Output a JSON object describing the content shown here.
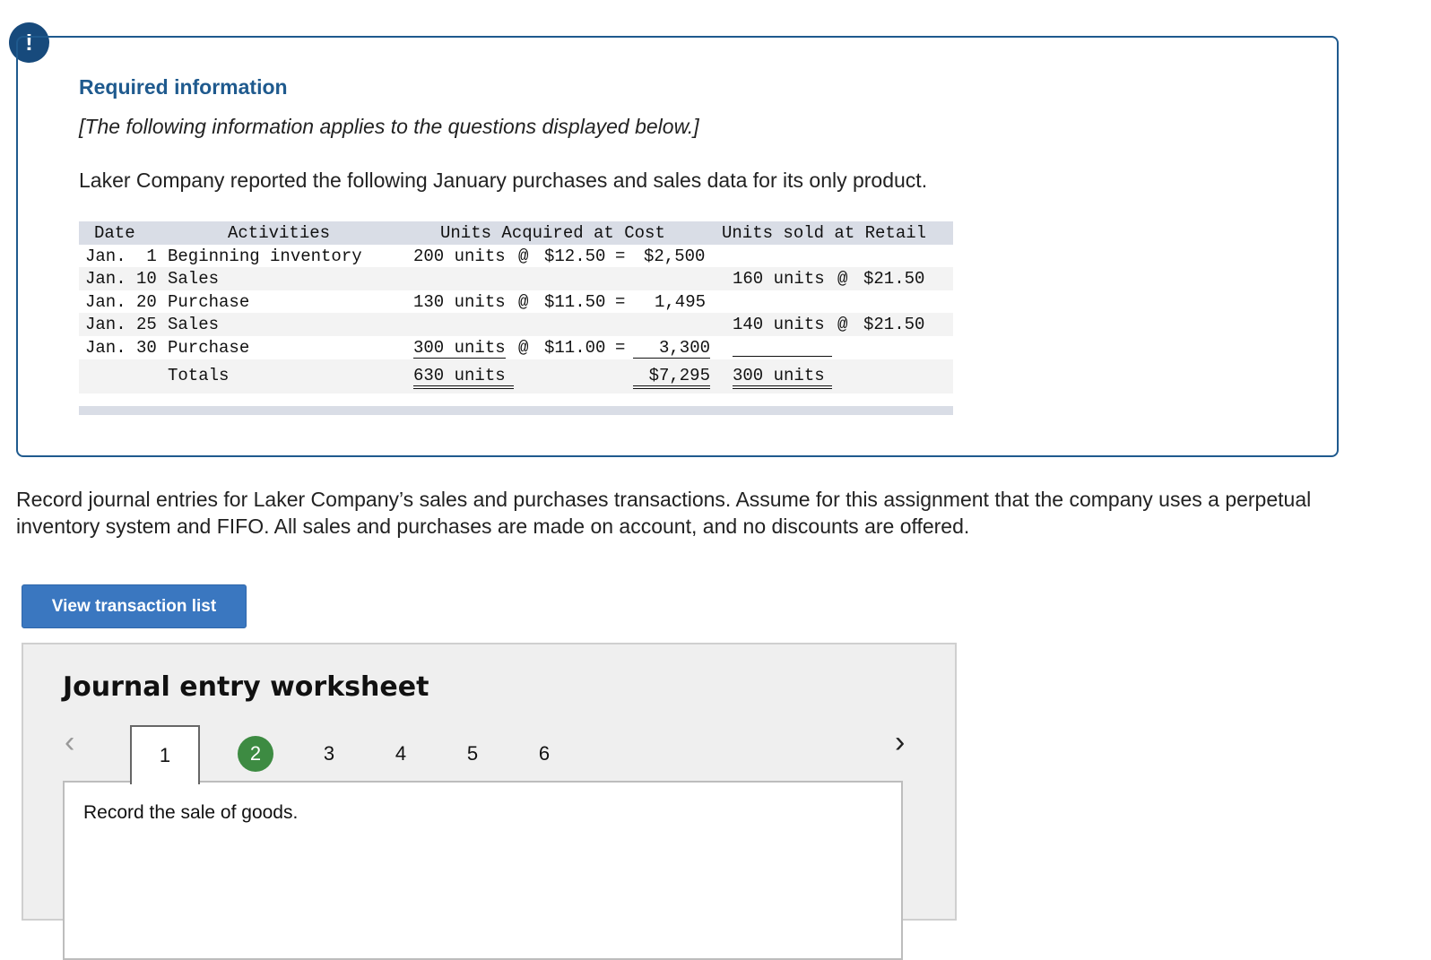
{
  "info": {
    "badge": "!",
    "title": "Required information",
    "note": "[The following information applies to the questions displayed below.]",
    "intro": "Laker Company reported the following January purchases and sales data for its only product."
  },
  "table": {
    "headers": {
      "date": "Date",
      "activities": "Activities",
      "acquired": "Units Acquired at Cost",
      "sold": "Units sold at Retail"
    },
    "rows": [
      {
        "date": "Jan.  1",
        "activity": "Beginning inventory",
        "acq_units": "200 units",
        "acq_at": "@",
        "acq_cost": "$12.50",
        "acq_eq": "=",
        "acq_total": "$2,500",
        "sold_units": "",
        "sold_at": "",
        "sold_price": ""
      },
      {
        "date": "Jan. 10",
        "activity": "Sales",
        "acq_units": "",
        "acq_at": "",
        "acq_cost": "",
        "acq_eq": "",
        "acq_total": "",
        "sold_units": "160 units",
        "sold_at": "@",
        "sold_price": "$21.50"
      },
      {
        "date": "Jan. 20",
        "activity": "Purchase",
        "acq_units": "130 units",
        "acq_at": "@",
        "acq_cost": "$11.50",
        "acq_eq": "=",
        "acq_total": "1,495",
        "sold_units": "",
        "sold_at": "",
        "sold_price": ""
      },
      {
        "date": "Jan. 25",
        "activity": "Sales",
        "acq_units": "",
        "acq_at": "",
        "acq_cost": "",
        "acq_eq": "",
        "acq_total": "",
        "sold_units": "140 units",
        "sold_at": "@",
        "sold_price": "$21.50"
      },
      {
        "date": "Jan. 30",
        "activity": "Purchase",
        "acq_units": "300 units",
        "acq_at": "@",
        "acq_cost": "$11.00",
        "acq_eq": "=",
        "acq_total": "3,300",
        "sold_units": "",
        "sold_at": "",
        "sold_price": ""
      }
    ],
    "totals": {
      "label": "Totals",
      "acq_units": "630 units",
      "acq_total": "$7,295",
      "sold_units": "300 units"
    }
  },
  "instructions": "Record journal entries for Laker Company’s sales and purchases transactions. Assume for this assignment that the company uses a perpetual inventory system and FIFO. All sales and purchases are made on account, and no discounts are offered.",
  "view_button": "View transaction list",
  "worksheet": {
    "title": "Journal entry worksheet",
    "prev_icon": "chevron-left-icon",
    "next_icon": "chevron-right-icon",
    "prev_glyph": "‹",
    "next_glyph": "›",
    "pages": [
      "1",
      "2",
      "3",
      "4",
      "5",
      "6"
    ],
    "active_page": "1",
    "completed_page": "2",
    "prompt": "Record the sale of goods."
  },
  "colors": {
    "accent": "#1f5a8e",
    "button": "#3a77c0",
    "completed": "#3d8b42",
    "table_header": "#d9dde6"
  }
}
